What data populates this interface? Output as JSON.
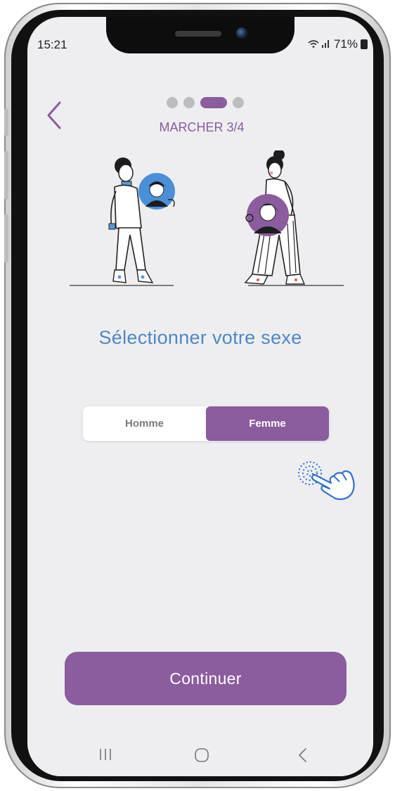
{
  "status_bar": {
    "time": "15:21",
    "battery": "71%"
  },
  "onboarding": {
    "step_label": "MARCHER 3/4",
    "total_steps": 4,
    "current_step": 3,
    "question": "Sélectionner votre sexe",
    "options": [
      {
        "label": "Homme",
        "selected": false
      },
      {
        "label": "Femme",
        "selected": true
      }
    ],
    "continue_label": "Continuer"
  },
  "colors": {
    "accent": "#8b5c9e",
    "question": "#4d88c2",
    "background": "#eeeef0"
  },
  "icons": {
    "back": "chevron-left-icon",
    "tap_hint": "hand-tap-icon",
    "wifi": "wifi-icon",
    "signal": "signal-icon",
    "battery": "battery-icon"
  }
}
